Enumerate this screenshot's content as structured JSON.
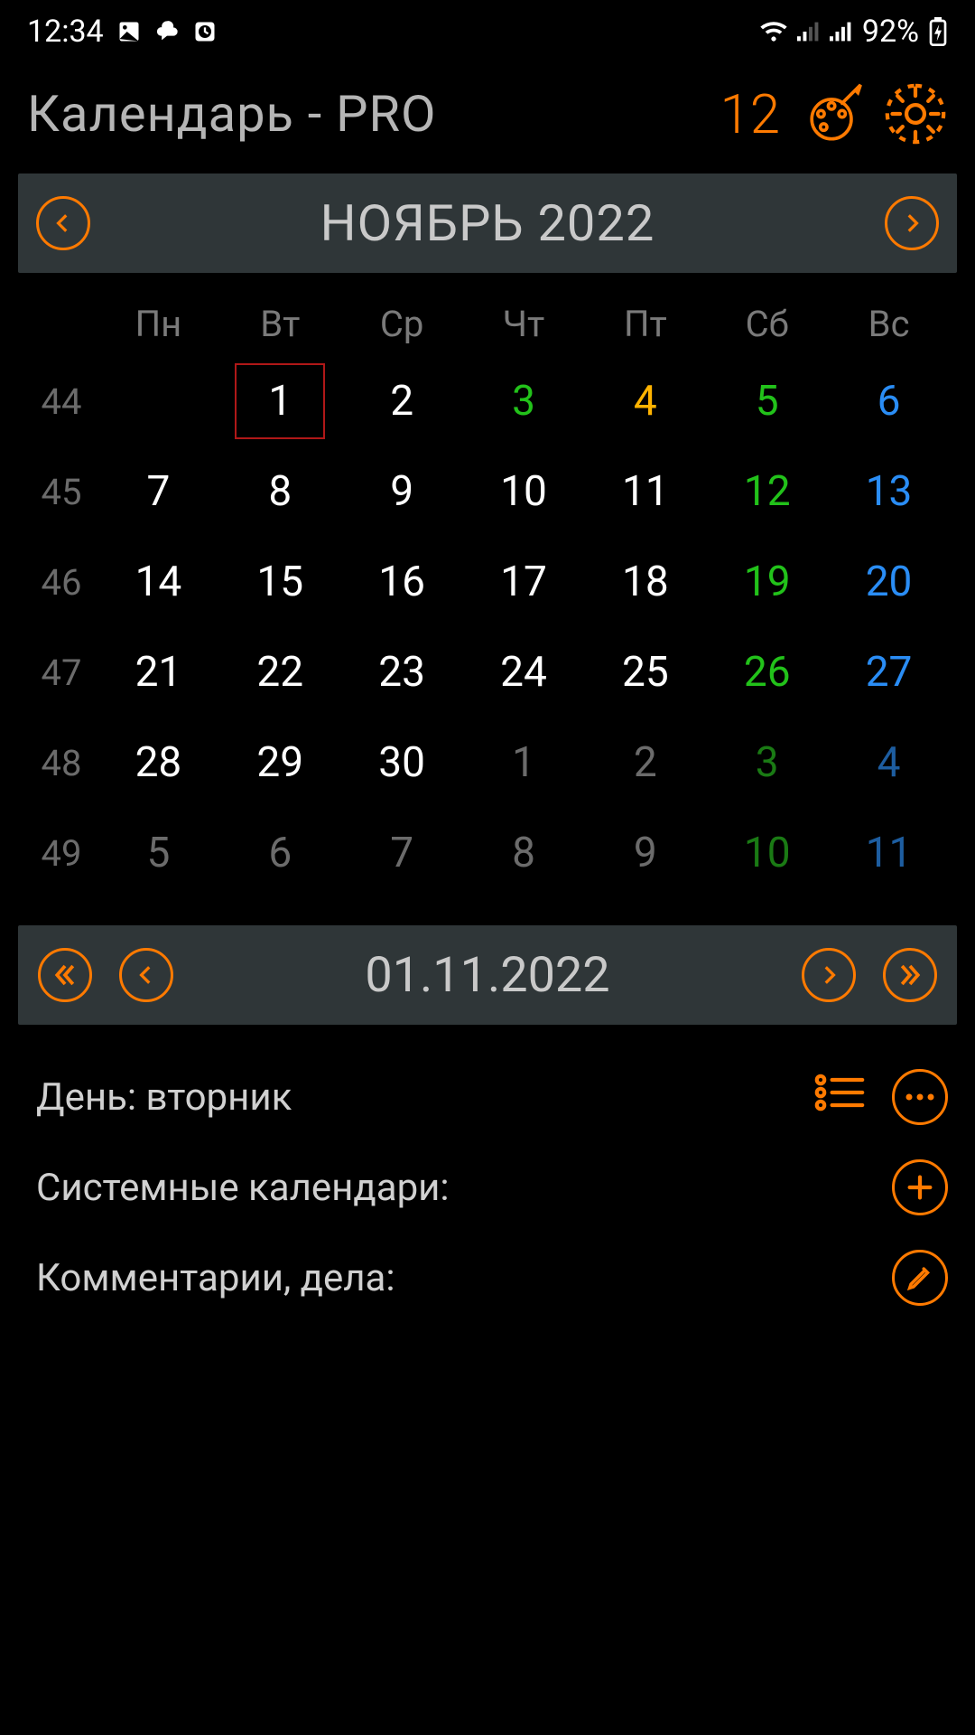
{
  "statusbar": {
    "time": "12:34",
    "battery": "92%"
  },
  "header": {
    "title": "Календарь - PRO",
    "today_num": "12"
  },
  "month_bar": {
    "title": "НОЯБРЬ 2022"
  },
  "weekdays": [
    "Пн",
    "Вт",
    "Ср",
    "Чт",
    "Пт",
    "Сб",
    "Вс"
  ],
  "weeks": [
    {
      "wn": "44",
      "days": [
        {
          "n": "",
          "cls": "c-grey"
        },
        {
          "n": "1",
          "cls": "c-white",
          "sel": true
        },
        {
          "n": "2",
          "cls": "c-white"
        },
        {
          "n": "3",
          "cls": "c-green"
        },
        {
          "n": "4",
          "cls": "c-orange"
        },
        {
          "n": "5",
          "cls": "c-green"
        },
        {
          "n": "6",
          "cls": "c-blue"
        }
      ]
    },
    {
      "wn": "45",
      "days": [
        {
          "n": "7",
          "cls": "c-white"
        },
        {
          "n": "8",
          "cls": "c-white"
        },
        {
          "n": "9",
          "cls": "c-white"
        },
        {
          "n": "10",
          "cls": "c-white"
        },
        {
          "n": "11",
          "cls": "c-white"
        },
        {
          "n": "12",
          "cls": "c-green"
        },
        {
          "n": "13",
          "cls": "c-blue"
        }
      ]
    },
    {
      "wn": "46",
      "days": [
        {
          "n": "14",
          "cls": "c-white"
        },
        {
          "n": "15",
          "cls": "c-white"
        },
        {
          "n": "16",
          "cls": "c-white"
        },
        {
          "n": "17",
          "cls": "c-white"
        },
        {
          "n": "18",
          "cls": "c-white"
        },
        {
          "n": "19",
          "cls": "c-green"
        },
        {
          "n": "20",
          "cls": "c-blue"
        }
      ]
    },
    {
      "wn": "47",
      "days": [
        {
          "n": "21",
          "cls": "c-white"
        },
        {
          "n": "22",
          "cls": "c-white"
        },
        {
          "n": "23",
          "cls": "c-white"
        },
        {
          "n": "24",
          "cls": "c-white"
        },
        {
          "n": "25",
          "cls": "c-white"
        },
        {
          "n": "26",
          "cls": "c-green"
        },
        {
          "n": "27",
          "cls": "c-blue"
        }
      ]
    },
    {
      "wn": "48",
      "days": [
        {
          "n": "28",
          "cls": "c-white"
        },
        {
          "n": "29",
          "cls": "c-white"
        },
        {
          "n": "30",
          "cls": "c-white"
        },
        {
          "n": "1",
          "cls": "c-grey"
        },
        {
          "n": "2",
          "cls": "c-grey"
        },
        {
          "n": "3",
          "cls": "c-dgreen"
        },
        {
          "n": "4",
          "cls": "c-dblue"
        }
      ]
    },
    {
      "wn": "49",
      "days": [
        {
          "n": "5",
          "cls": "c-grey"
        },
        {
          "n": "6",
          "cls": "c-grey"
        },
        {
          "n": "7",
          "cls": "c-grey"
        },
        {
          "n": "8",
          "cls": "c-grey"
        },
        {
          "n": "9",
          "cls": "c-grey"
        },
        {
          "n": "10",
          "cls": "c-dgreen"
        },
        {
          "n": "11",
          "cls": "c-dblue"
        }
      ]
    }
  ],
  "date_nav": {
    "date": "01.11.2022"
  },
  "info": {
    "day_label": "День: вторник",
    "system_cal": "Системные календари:",
    "comments": "Комментарии, дела:"
  }
}
